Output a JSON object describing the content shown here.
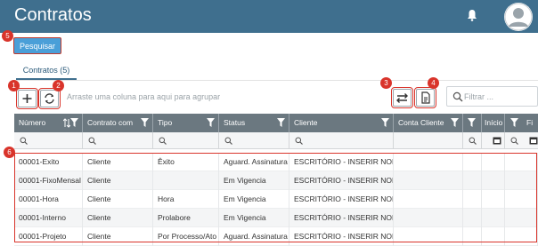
{
  "app": {
    "title": "Contratos"
  },
  "header": {
    "bell_icon": "bell-icon",
    "avatar_icon": "user-avatar-icon"
  },
  "actions": {
    "search_label": "Pesquisar"
  },
  "tabs": [
    {
      "label": "Contratos (5)"
    }
  ],
  "toolbar": {
    "group_hint": "Arraste uma coluna para aqui para agrupar",
    "filter_placeholder": "Filtrar ..."
  },
  "annotations": [
    "1",
    "2",
    "3",
    "4",
    "5",
    "6"
  ],
  "grid": {
    "columns": [
      "Número",
      "Contrato com",
      "Tipo",
      "Status",
      "Cliente",
      "Conta Cliente",
      "",
      "Início",
      "Fi"
    ],
    "rows": [
      [
        "00001-Exito",
        "Cliente",
        "Êxito",
        "Aguard. Assinatura",
        "ESCRITÓRIO - INSERIR NOME"
      ],
      [
        "00001-FixoMensal",
        "Cliente",
        "",
        "Em Vigencia",
        "ESCRITÓRIO - INSERIR NOME"
      ],
      [
        "00001-Hora",
        "Cliente",
        "Hora",
        "Em Vigencia",
        "ESCRITÓRIO - INSERIR NOME"
      ],
      [
        "00001-Interno",
        "Cliente",
        "Prolabore",
        "Em Vigencia",
        "ESCRITÓRIO - INSERIR NOME"
      ],
      [
        "00001-Projeto",
        "Cliente",
        "Por Processo/Ato",
        "Aguard. Assinatura",
        "ESCRITÓRIO - INSERIR NOME"
      ]
    ]
  },
  "colors": {
    "topbar": "#3f6f8e",
    "header": "#6b7880",
    "accent": "#4a9fd8",
    "annotation": "#d9342b"
  }
}
